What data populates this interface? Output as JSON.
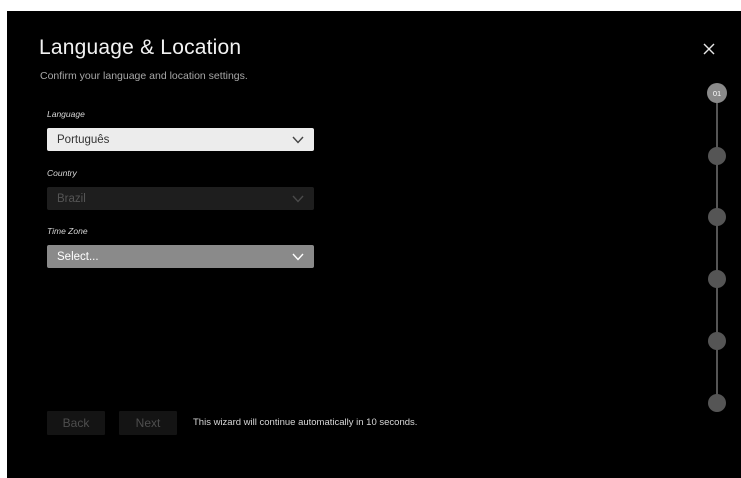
{
  "header": {
    "title": "Language & Location",
    "subtitle": "Confirm your language and location settings."
  },
  "close_icon": "close-icon",
  "fields": {
    "language": {
      "label": "Language",
      "value": "Português"
    },
    "country": {
      "label": "Country",
      "value": "Brazil",
      "state": "disabled"
    },
    "timezone": {
      "label": "Time Zone",
      "value": "Select...",
      "state": "focused"
    }
  },
  "footer": {
    "back_label": "Back",
    "next_label": "Next",
    "auto_message": "This wizard will continue automatically in 10 seconds."
  },
  "stepper": {
    "current_label": "01",
    "current_step": 1,
    "total_steps": 6
  },
  "colors": {
    "background": "#000000",
    "language_dropdown": "#ececec",
    "country_dropdown": "#1e1e1e",
    "timezone_dropdown": "#8a8a8a",
    "step_active": "#8a8a8a",
    "step_inactive": "#555555"
  }
}
